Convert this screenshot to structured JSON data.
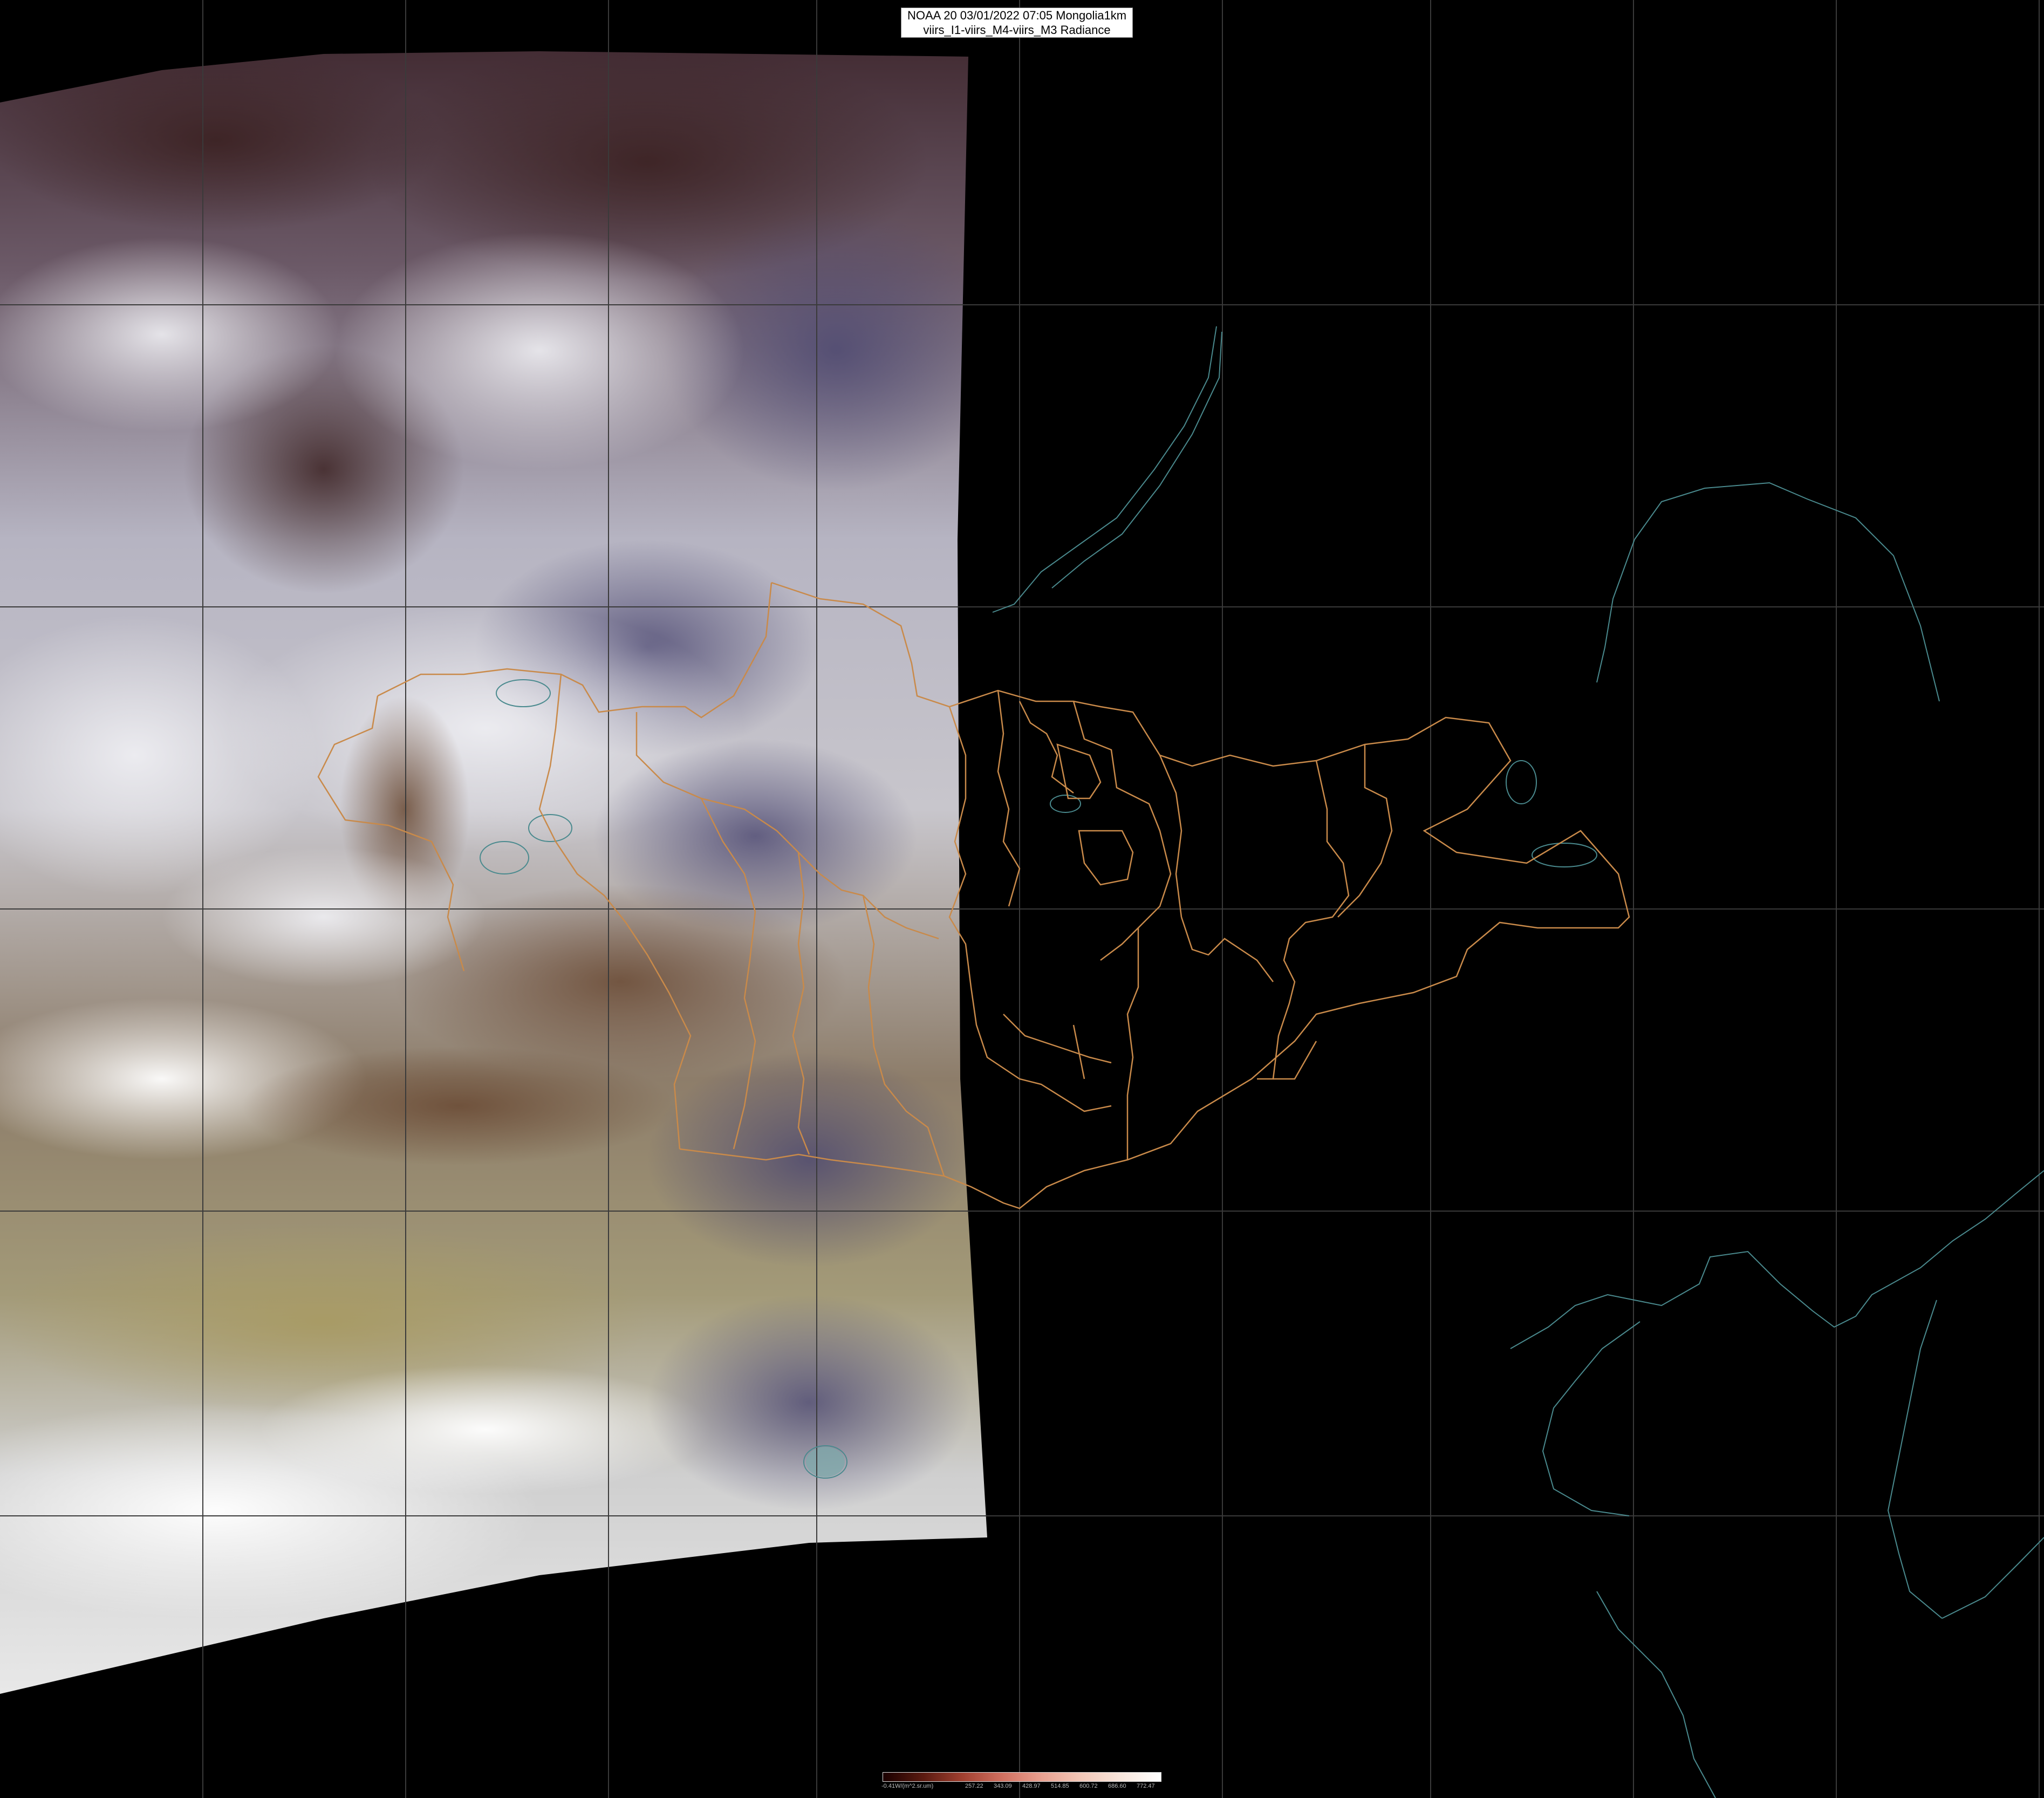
{
  "title": {
    "line1": "NOAA 20 03/01/2022 07:05 Mongolia1km",
    "line2": "viirs_I1-viirs_M4-viirs_M3 Radiance"
  },
  "colorbar": {
    "labels": [
      "-0.41W/(m^2.sr.um)",
      "257.22",
      "343.09",
      "428.97",
      "514.85",
      "600.72",
      "686.60",
      "772.47"
    ],
    "colors": [
      "#1a0000",
      "#5a1a10",
      "#a04030",
      "#d07060",
      "#e8a090",
      "#f2c8b8",
      "#f8e6dc",
      "#ffffff"
    ]
  },
  "colors": {
    "background": "#000000",
    "admin_borders": "#c98a4a",
    "coastlines": "#4a8a8e",
    "graticule": "#3a3a3a",
    "swath_dark_top": "#3a2228",
    "swath_cloud": "#d8d8e0",
    "swath_desert": "#9e9064",
    "swath_snow": "#f4f4f4"
  }
}
